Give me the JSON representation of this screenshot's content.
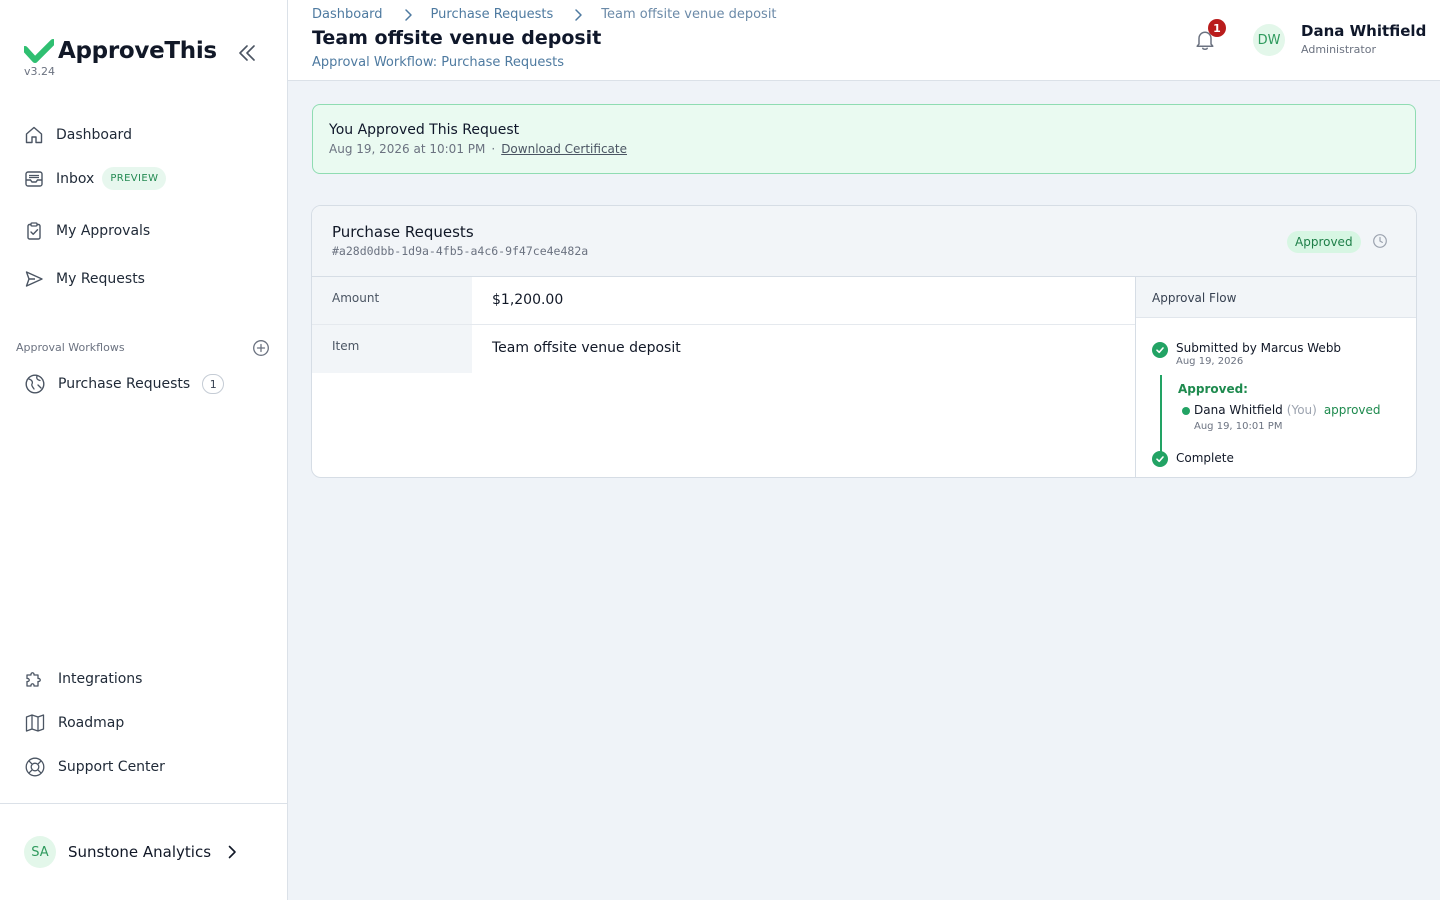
{
  "app": {
    "name": "ApproveThis",
    "version": "v3.24",
    "brand_color": "#2fbf71"
  },
  "sidebar": {
    "nav": [
      {
        "label": "Dashboard",
        "icon": "home-icon"
      },
      {
        "label": "Inbox",
        "icon": "inbox-icon",
        "badge": "PREVIEW"
      },
      {
        "label": "My Approvals",
        "icon": "clipboard-check-icon"
      },
      {
        "label": "My Requests",
        "icon": "send-icon"
      }
    ],
    "workflows_label": "Approval Workflows",
    "workflows": [
      {
        "label": "Purchase Requests",
        "icon": "globe-icon",
        "count": "1"
      }
    ],
    "bottom_nav": [
      {
        "label": "Integrations",
        "icon": "puzzle-icon"
      },
      {
        "label": "Roadmap",
        "icon": "map-icon"
      },
      {
        "label": "Support Center",
        "icon": "lifebuoy-icon"
      }
    ],
    "org": {
      "initials": "SA",
      "name": "Sunstone Analytics"
    }
  },
  "header": {
    "breadcrumb": [
      "Dashboard",
      "Purchase Requests",
      "Team offsite venue deposit"
    ],
    "title": "Team offsite venue deposit",
    "subtitle": "Approval Workflow: Purchase Requests",
    "notification_count": "1",
    "user": {
      "initials": "DW",
      "name": "Dana Whitfield",
      "role": "Administrator"
    }
  },
  "banner": {
    "title": "You Approved This Request",
    "timestamp": "Aug 19, 2026 at 10:01 PM",
    "separator": "·",
    "link": "Download Certificate"
  },
  "request": {
    "workflow": "Purchase Requests",
    "id": "#a28d0dbb-1d9a-4fb5-a4c6-9f47ce4e482a",
    "status": "Approved",
    "fields": [
      {
        "key": "Amount",
        "value": "$1,200.00"
      },
      {
        "key": "Item",
        "value": "Team offsite venue deposit"
      }
    ]
  },
  "flow": {
    "title": "Approval Flow",
    "submitted": {
      "text": "Submitted by Marcus Webb",
      "date": "Aug 19, 2026"
    },
    "approved_label": "Approved:",
    "approver": {
      "name": "Dana Whitfield",
      "you": "(You)",
      "status": "approved",
      "date": "Aug 19, 10:01 PM"
    },
    "complete": "Complete"
  }
}
